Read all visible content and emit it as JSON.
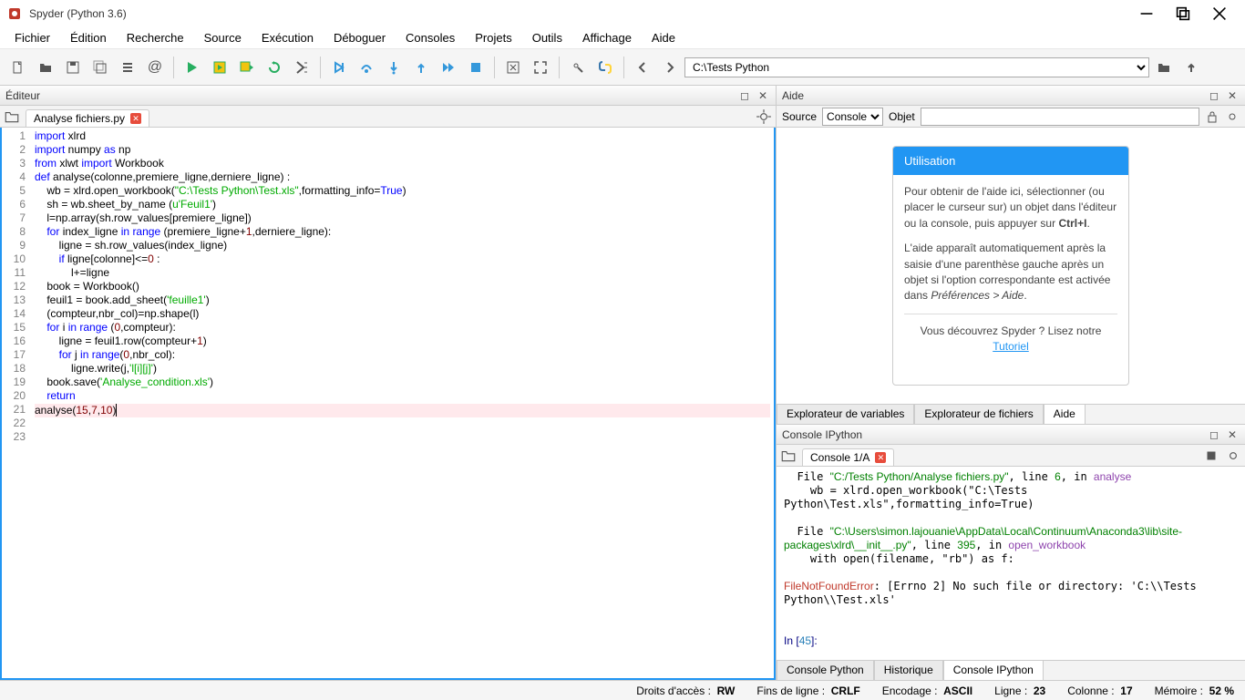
{
  "title": "Spyder (Python 3.6)",
  "menu": [
    "Fichier",
    "Édition",
    "Recherche",
    "Source",
    "Exécution",
    "Déboguer",
    "Consoles",
    "Projets",
    "Outils",
    "Affichage",
    "Aide"
  ],
  "path": "C:\\Tests Python",
  "editor": {
    "pane": "Éditeur",
    "tab": "Analyse fichiers.py",
    "lines": [
      {
        "n": 1,
        "h": "<span class='k'>import</span> xlrd"
      },
      {
        "n": 2,
        "h": "<span class='k'>import</span> numpy <span class='k'>as</span> np"
      },
      {
        "n": 3,
        "h": "<span class='k'>from</span> xlwt <span class='k'>import</span> Workbook"
      },
      {
        "n": 4,
        "h": ""
      },
      {
        "n": 5,
        "h": "<span class='k'>def</span> analyse(colonne,premiere_ligne,derniere_ligne) :"
      },
      {
        "n": 6,
        "h": "    wb = xlrd.open_workbook(<span class='s'>\"C:\\Tests Python\\Test.xls\"</span>,formatting_info=<span class='k'>True</span>)"
      },
      {
        "n": 7,
        "h": "    sh = wb.sheet_by_name (<span class='s'>u'Feuil1'</span>)"
      },
      {
        "n": 8,
        "h": "    l=np.array(sh.row_values[premiere_ligne])"
      },
      {
        "n": 9,
        "h": "    <span class='k'>for</span> index_ligne <span class='k'>in</span> <span class='k'>range</span> (premiere_ligne+<span class='n'>1</span>,derniere_ligne):"
      },
      {
        "n": 10,
        "h": "        ligne = sh.row_values(index_ligne)"
      },
      {
        "n": 11,
        "h": "        <span class='k'>if</span> ligne[colonne]&lt;=<span class='n'>0</span> :"
      },
      {
        "n": 12,
        "h": "            l+=ligne"
      },
      {
        "n": 13,
        "h": "    book = Workbook()"
      },
      {
        "n": 14,
        "h": "    feuil1 = book.add_sheet(<span class='s'>'feuille1'</span>)"
      },
      {
        "n": 15,
        "h": "    (compteur,nbr_col)=np.shape(l)"
      },
      {
        "n": 16,
        "h": "    <span class='k'>for</span> i <span class='k'>in</span> <span class='k'>range</span> (<span class='n'>0</span>,compteur):"
      },
      {
        "n": 17,
        "h": "        ligne = feuil1.row(compteur+<span class='n'>1</span>)"
      },
      {
        "n": 18,
        "h": "        <span class='k'>for</span> j <span class='k'>in</span> <span class='k'>range</span>(<span class='n'>0</span>,nbr_col):"
      },
      {
        "n": 19,
        "h": "            ligne.write(j,<span class='s'>'l[i][j]'</span>)"
      },
      {
        "n": 20,
        "h": "    book.save(<span class='s'>'Analyse_condition.xls'</span>)"
      },
      {
        "n": 21,
        "h": "    <span class='k'>return</span>"
      },
      {
        "n": 22,
        "h": ""
      },
      {
        "n": 23,
        "h": "analyse(<span class='n'>15</span>,<span class='n'>7</span>,<span class='n'>10</span>)<span style='border-left:1px solid #000'>&nbsp;</span>",
        "cur": true
      }
    ]
  },
  "help": {
    "pane": "Aide",
    "sourceLabel": "Source",
    "sourceValue": "Console",
    "objectLabel": "Objet",
    "card": {
      "title": "Utilisation",
      "p1": "Pour obtenir de l'aide ici, sélectionner (ou placer le curseur sur) un objet dans l'éditeur ou la console, puis appuyer sur ",
      "p1b": "Ctrl+I",
      "p2": "L'aide apparaît automatiquement après la saisie d'une parenthèse gauche après un objet si l'option correspondante est activée dans ",
      "p2i": "Préférences > Aide",
      "p3": "Vous découvrez Spyder ? Lisez notre",
      "link": "Tutoriel"
    },
    "tabs": [
      "Explorateur de variables",
      "Explorateur de fichiers",
      "Aide"
    ]
  },
  "ipy": {
    "pane": "Console IPython",
    "tab": "Console 1/A",
    "bottomtabs": [
      "Console Python",
      "Historique",
      "Console IPython"
    ],
    "lines": [
      "  File <span class='cgrn'>\"C:/Tests Python/Analyse fichiers.py\"</span>, line <span class='cgrn'>6</span>, in <span class='cpur'>analyse</span>",
      "    wb = xlrd.open_workbook(\"C:\\Tests Python\\Test.xls\",formatting_info=True)",
      "",
      "  File <span class='cgrn'>\"C:\\Users\\simon.lajouanie\\AppData\\Local\\Continuum\\Anaconda3\\lib\\site-packages\\xlrd\\__init__.py\"</span>, line <span class='cgrn'>395</span>, in <span class='cpur'>open_workbook</span>",
      "    with open(filename, \"rb\") as f:",
      "",
      "<span class='cred'>FileNotFoundError</span>: [Errno 2] No such file or directory: 'C:\\\\Tests Python\\\\Test.xls'",
      "",
      "",
      "<span class='cnav'>In [</span><span class='cblu'>45</span><span class='cnav'>]:</span> "
    ]
  },
  "status": {
    "perm_l": "Droits d'accès :",
    "perm_v": "RW",
    "eol_l": "Fins de ligne :",
    "eol_v": "CRLF",
    "enc_l": "Encodage :",
    "enc_v": "ASCII",
    "line_l": "Ligne :",
    "line_v": "23",
    "col_l": "Colonne :",
    "col_v": "17",
    "mem_l": "Mémoire :",
    "mem_v": "52 %"
  }
}
